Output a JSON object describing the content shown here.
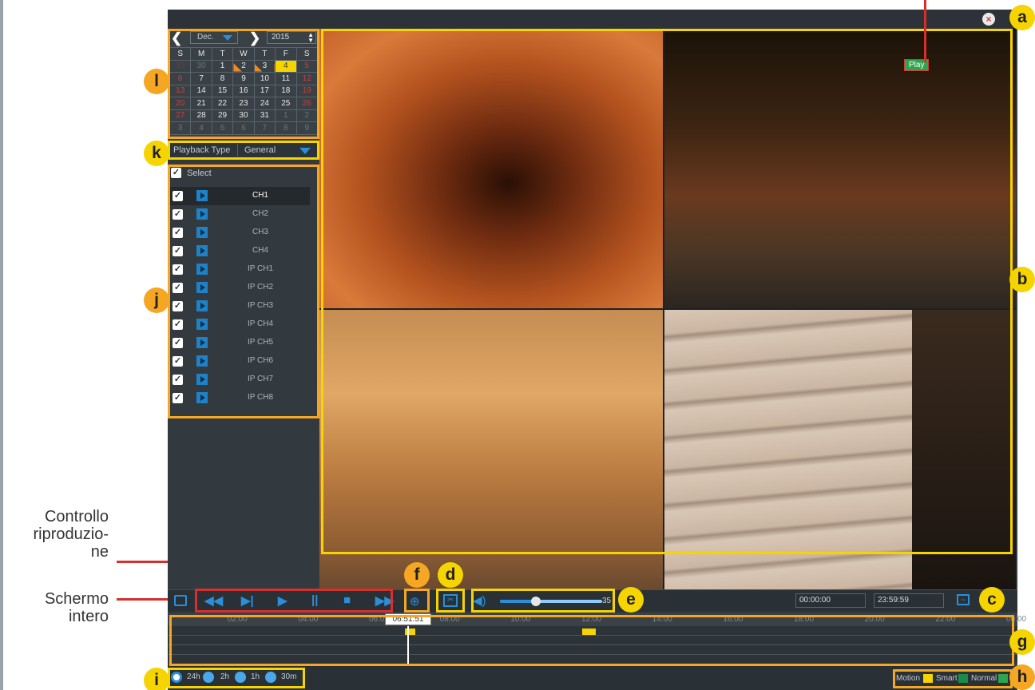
{
  "calendar": {
    "month": "Dec.",
    "year": "2015",
    "weekdays": [
      "S",
      "M",
      "T",
      "W",
      "T",
      "F",
      "S"
    ],
    "weeks": [
      [
        "29",
        "30",
        "1",
        "2",
        "3",
        "4",
        "5"
      ],
      [
        "6",
        "7",
        "8",
        "9",
        "10",
        "11",
        "12"
      ],
      [
        "13",
        "14",
        "15",
        "16",
        "17",
        "18",
        "19"
      ],
      [
        "20",
        "21",
        "22",
        "23",
        "24",
        "25",
        "26"
      ],
      [
        "27",
        "28",
        "29",
        "30",
        "31",
        "1",
        "2"
      ],
      [
        "3",
        "4",
        "5",
        "6",
        "7",
        "8",
        "9"
      ]
    ],
    "selected_day": "4",
    "days_with_recordings": [
      "2",
      "3"
    ]
  },
  "playback_type": {
    "label": "Playback Type",
    "value": "General"
  },
  "channels": {
    "select_label": "Select",
    "list": [
      "CH1",
      "CH2",
      "CH3",
      "CH4",
      "IP CH1",
      "IP CH2",
      "IP CH3",
      "IP CH4",
      "IP CH5",
      "IP CH6",
      "IP CH7",
      "IP CH8"
    ],
    "active": "CH1"
  },
  "video": {
    "status_tag": "Play"
  },
  "controls": {
    "volume": 35,
    "volume_label": "35",
    "start_time": "00:00:00",
    "end_time": "23:59:59",
    "icons": [
      "fullscreen-icon",
      "rewind-icon",
      "step-icon",
      "play-icon",
      "pause-icon",
      "stop-icon",
      "fast-forward-icon",
      "zoom-icon",
      "clip-icon",
      "volume-icon",
      "waveform-icon"
    ]
  },
  "timeline": {
    "hour_labels": [
      "02:00",
      "04:00",
      "06:00",
      "08:00",
      "10:00",
      "12:00",
      "14:00",
      "16:00",
      "18:00",
      "20:00",
      "22:00",
      "00:00"
    ],
    "current_time": "06:51:51",
    "recording_marks_hours": [
      [
        6.7,
        7.0
      ],
      [
        11.7,
        12.1
      ]
    ]
  },
  "zoom_options": [
    "24h",
    "2h",
    "1h",
    "30m"
  ],
  "legend": [
    {
      "label": "Motion",
      "color": "#f5d400"
    },
    {
      "label": "Smart",
      "color": "#1a8c4a"
    },
    {
      "label": "Normal",
      "color": "#2ea44f"
    }
  ],
  "annotations": {
    "badges": [
      "a",
      "b",
      "c",
      "d",
      "e",
      "f",
      "g",
      "h",
      "i",
      "j",
      "k",
      "l"
    ],
    "playback_control_label": "Controllo riproduzio- ne",
    "fullscreen_label": "Schermo intero"
  }
}
